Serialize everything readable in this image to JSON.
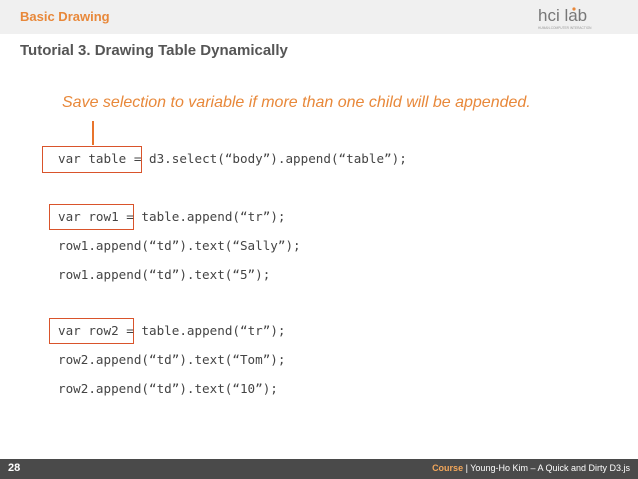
{
  "header": {
    "section": "Basic Drawing",
    "title": "Tutorial 3. Drawing Table Dynamically",
    "logo_text": "hci lab",
    "logo_subtext": "HUMAN-COMPUTER INTERACTION"
  },
  "slide": {
    "note": "Save selection to variable if more than one child will be appended.",
    "code": [
      {
        "var": "var table",
        "rest": " = d3.select(“body”).append(“table”);"
      },
      {
        "var": "var row1",
        "rest": " = table.append(“tr”);"
      },
      {
        "text": "row1.append(“td”).text(“Sally”);"
      },
      {
        "text": "row1.append(“td”).text(“5”);"
      },
      {
        "var": "var row2",
        "rest": " = table.append(“tr”);"
      },
      {
        "text": "row2.append(“td”).text(“Tom”);"
      },
      {
        "text": "row2.append(“td”).text(“10”);"
      }
    ]
  },
  "footer": {
    "page": "28",
    "course_label": "Course",
    "course_info": " | Young-Ho Kim – A Quick and Dirty D3.js"
  },
  "colors": {
    "accent": "#e8883a",
    "highlight": "#d9542b",
    "footer_bg": "#4a4a4a",
    "title": "#555555"
  }
}
